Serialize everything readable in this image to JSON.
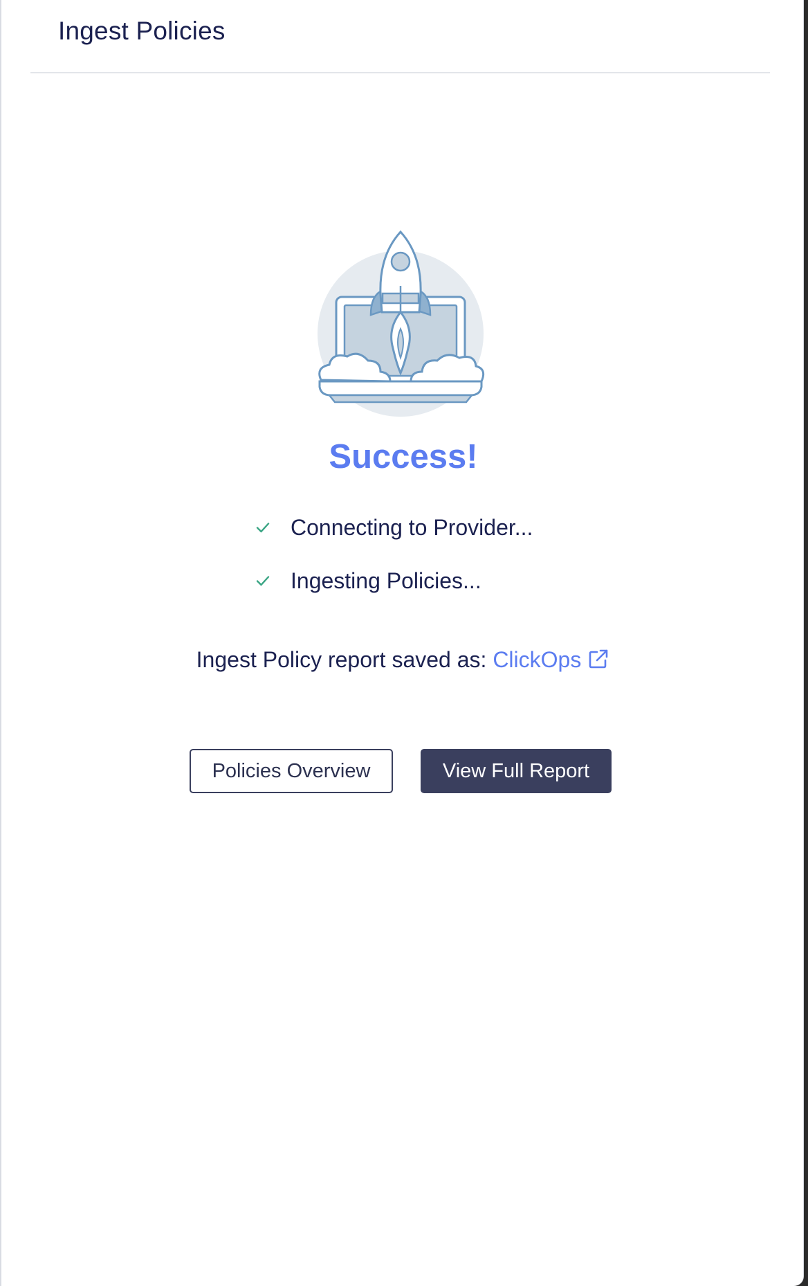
{
  "header": {
    "title": "Ingest Policies"
  },
  "illustration": {
    "icon": "rocket-launch-laptop-icon"
  },
  "status": {
    "title": "Success!",
    "steps": [
      {
        "label": "Connecting to Provider...",
        "icon": "check-icon"
      },
      {
        "label": "Ingesting Policies...",
        "icon": "check-icon"
      }
    ]
  },
  "report": {
    "prefix": "Ingest Policy report saved as:",
    "link_text": "ClickOps",
    "link_icon": "external-link-icon"
  },
  "actions": {
    "secondary_label": "Policies Overview",
    "primary_label": "View Full Report"
  },
  "colors": {
    "accent": "#5b7cf0",
    "text": "#1b2150",
    "primary_button": "#3a3f5e",
    "check": "#3aa584"
  }
}
